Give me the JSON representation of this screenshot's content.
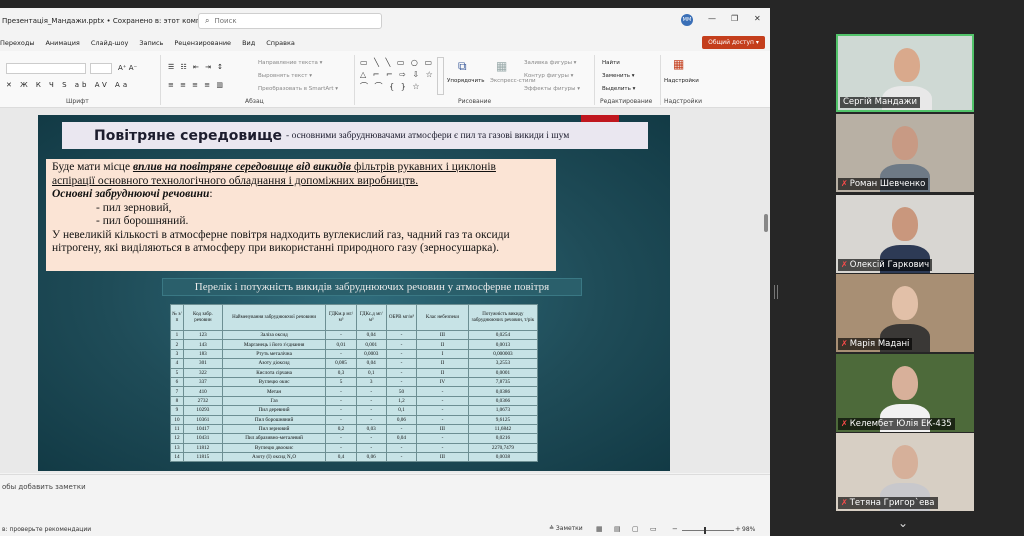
{
  "window": {
    "doc_title": "Презентація_Мандажи.pptx  •  Сохранено в: этот компьютер ⌄",
    "search_placeholder": "Поиск",
    "avatar_initials": "MM",
    "share_label": "Общий доступ ▾"
  },
  "menu": [
    "Переходы",
    "Анимация",
    "Слайд-шоу",
    "Запись",
    "Рецензирование",
    "Вид",
    "Справка"
  ],
  "ribbon": {
    "groups": [
      "Шрифт",
      "Абзац",
      "Рисование",
      "Редактирование",
      "Надстройки"
    ],
    "paragraph_items": [
      "Направление текста ▾",
      "Выровнять текст ▾",
      "Преобразовать в SmartArt ▾"
    ],
    "drawing_items": [
      "Упорядочить",
      "Экспресс-стили",
      "Заливка фигуры ▾",
      "Контур фигуры ▾",
      "Эффекты фигуры ▾"
    ],
    "editing_items": [
      "Найти",
      "Заменить ▾",
      "Выделить ▾"
    ],
    "addins_label": "Надстройки"
  },
  "slide": {
    "title_main": "Повітряне середовище",
    "title_sub": " - основними забруднювачами атмосфери є пил та газові викиди і шум",
    "para1_a": "Буде мати місце ",
    "para1_link": " вплив на повітряне середовище від викидів ",
    "para1_b": "  фільтрів рукавних і циклонів",
    "para1_c": "аспірації основного технологічного обладнання і допоміжних виробництв.",
    "para2_heading": "Основні забруднюючі речовини",
    "para2_colon": ":",
    "item1": "- пил зерновий,",
    "item2": "- пил борошняний.",
    "para3": "У невеликій кількості в атмосферне повітря надходить вуглекислий газ, чадний газ та оксиди нітрогену, які виділяються в атмосферу при використанні природного газу (зерносушарка).",
    "table_title": "Перелік і потужність викидів забруднюючих речовин у атмосферне повітря"
  },
  "table": {
    "headers": [
      "№ з/п",
      "Код забр. речовин",
      "Найменування забруднюючої речовини",
      "ГДКм.р мг/м³",
      "ГДКс.д мг/м³",
      "ОБРВ мг/м³",
      "Клас небезпеки",
      "Потужність викиду забруднюючих речовин, т/рік"
    ],
    "rows": [
      [
        "1",
        "123",
        "Заліза оксид",
        "-",
        "0,04",
        "-",
        "III",
        "0,0254"
      ],
      [
        "2",
        "143",
        "Марганець і його з'єднання",
        "0,01",
        "0,001",
        "-",
        "II",
        "0,0013"
      ],
      [
        "3",
        "183",
        "Ртуть металічна",
        "-",
        "0,0003",
        "-",
        "I",
        "0,000003"
      ],
      [
        "4",
        "301",
        "Азоту діоксид",
        "0,085",
        "0,04",
        "-",
        "II",
        "3,2553"
      ],
      [
        "5",
        "322",
        "Кислота сірчана",
        "0,3",
        "0,1",
        "-",
        "II",
        "0,0001"
      ],
      [
        "6",
        "337",
        "Вуглецю окис",
        "5",
        "3",
        "-",
        "IV",
        "7,8735"
      ],
      [
        "7",
        "410",
        "Метан",
        "-",
        "-",
        "50",
        "-",
        "0,0386"
      ],
      [
        "8",
        "2732",
        "Газ",
        "-",
        "-",
        "1,2",
        "-",
        "0,0366"
      ],
      [
        "9",
        "10293",
        "Пил деревний",
        "-",
        "-",
        "0,1",
        "-",
        "1,0673"
      ],
      [
        "10",
        "10361",
        "Пил борошняний",
        "-",
        "-",
        "0,06",
        "-",
        "9,6125"
      ],
      [
        "11",
        "10417",
        "Пил зерновий",
        "0,2",
        "0,03",
        "-",
        "III",
        "11,6842"
      ],
      [
        "12",
        "10431",
        "Пил абразивно-металевий",
        "-",
        "-",
        "0,04",
        "-",
        "0,0216"
      ],
      [
        "13",
        "11812",
        "Вуглецю двоокис",
        "-",
        "-",
        "-",
        "-",
        "2270,7479"
      ],
      [
        "14",
        "11815",
        "Азоту (I) оксид N₂O",
        "0,4",
        "0,06",
        "-",
        "III",
        "0,0038"
      ]
    ]
  },
  "notes": {
    "placeholder": "обы добавить заметки",
    "status": "в: проверьте рекомендации",
    "notes_button": "≙ Заметки",
    "zoom": "98%"
  },
  "participants": [
    {
      "name": "Сергій Мандажи",
      "muted": false,
      "active": true,
      "bg": "#cfd9d4",
      "skin": "#d9a98c",
      "shirt": "#e8e8e8"
    },
    {
      "name": "Роман Шевченко",
      "muted": true,
      "active": false,
      "bg": "#b8b0a4",
      "skin": "#c89a84",
      "shirt": "#6e7a86"
    },
    {
      "name": "Олексій Гаркович",
      "muted": true,
      "active": false,
      "bg": "#d8d6d2",
      "skin": "#c9977d",
      "shirt": "#2d3a55"
    },
    {
      "name": "Марія Мадані",
      "muted": true,
      "active": false,
      "bg": "#a88f74",
      "skin": "#e2c0a8",
      "shirt": "#3a3836"
    },
    {
      "name": "Келембет Юлія ЕК-435",
      "muted": true,
      "active": false,
      "bg": "#4d6a3a",
      "skin": "#d8b09a",
      "shirt": "#f2f2f2"
    },
    {
      "name": "Тетяна Григор`ева",
      "muted": true,
      "active": false,
      "bg": "#d7cfc4",
      "skin": "#d6b09a",
      "shirt": "#c8c8cc"
    }
  ],
  "colors": {
    "share": "#c43e1c",
    "active_speaker": "#52c36a",
    "muted_icon": "#ff4b4b",
    "slide_bg": "#1f4c58",
    "text_box": "#fbe4d5",
    "table_bg": "#c7e3e6"
  }
}
